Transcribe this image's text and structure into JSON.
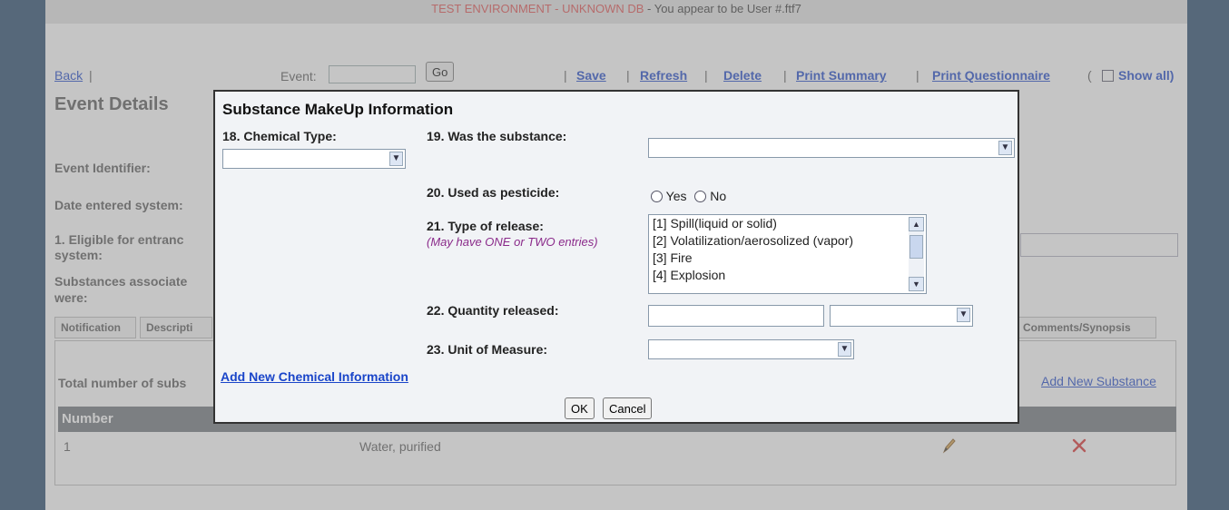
{
  "banner": {
    "env": "TEST ENVIRONMENT   - UNKNOWN DB",
    "user": " - You appear to be User #.ftf7"
  },
  "toolbar": {
    "back": "Back",
    "event_label": "Event:",
    "event_value": "",
    "go": "Go",
    "save": "Save",
    "refresh": "Refresh",
    "delete": "Delete",
    "print_summary": "Print Summary",
    "print_questionnaire": "Print Questionnaire",
    "show_all": "Show all)",
    "open_paren": "(",
    "pipe": "|"
  },
  "page": {
    "title": "Event Details",
    "event_identifier": "Event Identifier:",
    "date_entered": "Date entered system:",
    "eligible": "1. Eligible for entranc",
    "eligible_2": "system:",
    "substances_assoc": "Substances associate",
    "substances_assoc_2": "were:"
  },
  "tabs": {
    "notification": "Notification",
    "description": "Descripti",
    "comments": "Comments/Synopsis"
  },
  "substances": {
    "total_label": "Total number of subs",
    "add_new": "Add New Substance",
    "column_number": "Number",
    "rows": [
      {
        "number": "1",
        "name": "Water, purified"
      }
    ]
  },
  "modal": {
    "title": "Substance MakeUp Information",
    "q18_label": "18. Chemical Type:",
    "q18_value": "",
    "q19_label": "19. Was the substance:",
    "q19_value": "",
    "q20_label": "20. Used as pesticide:",
    "q20_yes": "Yes",
    "q20_no": "No",
    "q21_label": "21. Type of release:",
    "q21_note": "(May have ONE or TWO entries)",
    "q21_options": [
      "[1] Spill(liquid or solid)",
      "[2] Volatilization/aerosolized (vapor)",
      "[3] Fire",
      "[4] Explosion"
    ],
    "q22_label": "22. Quantity released:",
    "q22_value": "",
    "q22_unit": "",
    "q23_label": "23. Unit of Measure:",
    "q23_value": "",
    "add_chemical": "Add New Chemical Information",
    "ok": "OK",
    "cancel": "Cancel"
  }
}
